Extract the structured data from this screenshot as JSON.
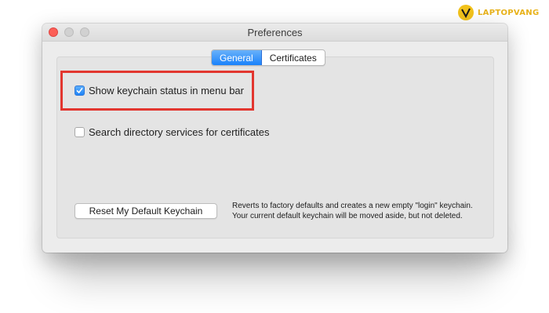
{
  "watermark": {
    "text": "LAPTOPVANG",
    "icon": "laptopvang-logo-icon",
    "color": "#e8b21a"
  },
  "window": {
    "title": "Preferences",
    "controls": {
      "close": "close-icon",
      "minimize": "minimize-icon",
      "zoom": "zoom-icon"
    }
  },
  "tabs": [
    {
      "label": "General",
      "selected": true
    },
    {
      "label": "Certificates",
      "selected": false
    }
  ],
  "options": [
    {
      "label": "Show keychain status in menu bar",
      "checked": true
    },
    {
      "label": "Search directory services for certificates",
      "checked": false
    }
  ],
  "reset": {
    "button_label": "Reset My Default Keychain",
    "description_line1": "Reverts to factory defaults and creates a new empty \"login\" keychain.",
    "description_line2": "Your current default keychain will be moved aside, but not deleted."
  },
  "colors": {
    "accent": "#1a82fb",
    "highlight_border": "#e2362f",
    "close_button": "#fc5f57"
  }
}
